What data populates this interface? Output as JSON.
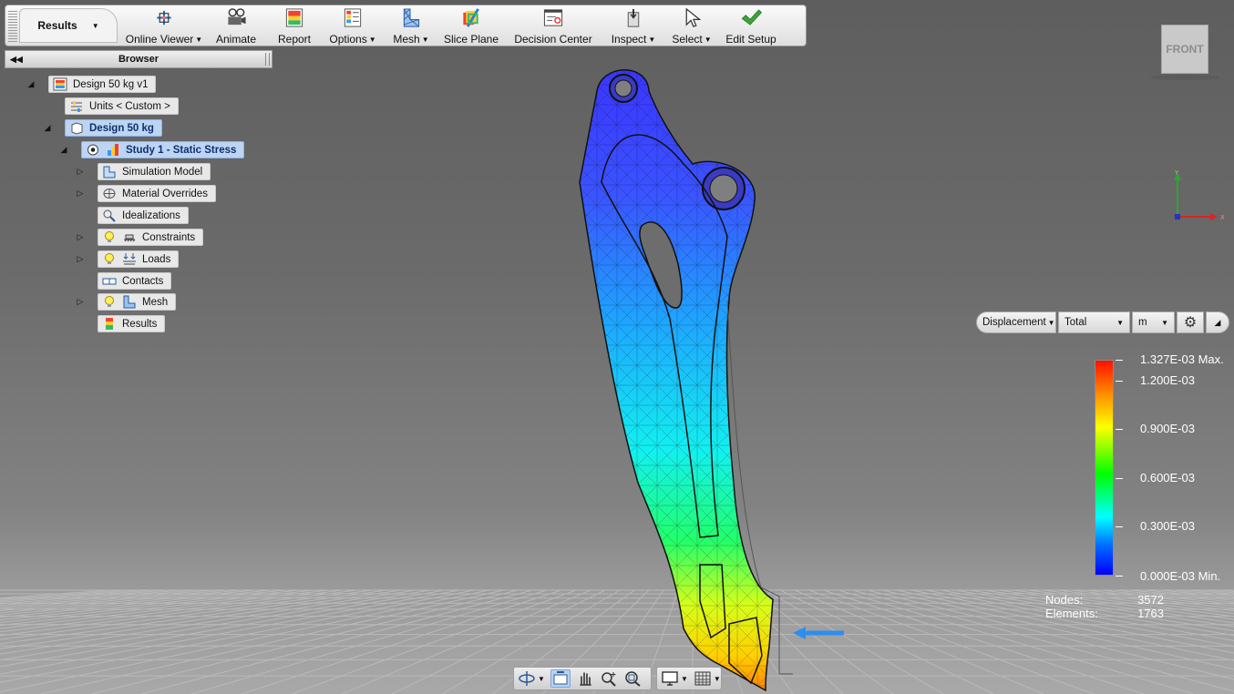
{
  "ribbon": {
    "results_tab": "Results",
    "buttons": [
      {
        "label": "Online Viewer",
        "dropdown": true
      },
      {
        "label": "Animate",
        "dropdown": false
      },
      {
        "label": "Report",
        "dropdown": false
      },
      {
        "label": "Options",
        "dropdown": true
      },
      {
        "label": "Mesh",
        "dropdown": true
      },
      {
        "label": "Slice Plane",
        "dropdown": false
      },
      {
        "label": "Decision Center",
        "dropdown": false
      },
      {
        "label": "Inspect",
        "dropdown": true
      },
      {
        "label": "Select",
        "dropdown": true
      },
      {
        "label": "Edit Setup",
        "dropdown": false
      }
    ]
  },
  "browser": {
    "title": "Browser",
    "tree": {
      "root": "Design 50 kg v1",
      "units": "Units < Custom >",
      "design": "Design 50 kg",
      "study": "Study 1 - Static Stress",
      "items": [
        "Simulation Model",
        "Material Overrides",
        "Idealizations",
        "Constraints",
        "Loads",
        "Contacts",
        "Mesh",
        "Results"
      ]
    }
  },
  "viewcube": {
    "face": "FRONT"
  },
  "result_controls": {
    "type": "Displacement",
    "component": "Total",
    "unit": "m"
  },
  "legend": {
    "max_label": "1.327E-03 Max.",
    "labels": [
      "1.200E-03",
      "0.900E-03",
      "0.600E-03",
      "0.300E-03"
    ],
    "min_label": "0.000E-03 Min.",
    "colors": [
      "#ff1000",
      "#ffff00",
      "#00ff00",
      "#00ffff",
      "#0000ff"
    ]
  },
  "stats": {
    "nodes_label": "Nodes:",
    "nodes": "3572",
    "elements_label": "Elements:",
    "elements": "1763"
  },
  "colors": {
    "accent_selected": "#bcd5f5",
    "edit_setup_check": "#3aa53a"
  }
}
